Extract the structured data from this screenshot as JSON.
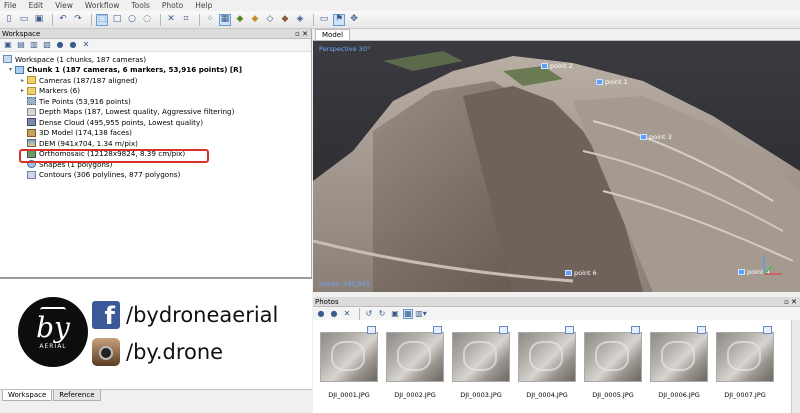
{
  "menu": [
    "File",
    "Edit",
    "View",
    "Workflow",
    "Tools",
    "Photo",
    "Help"
  ],
  "workspace": {
    "title": "Workspace",
    "tree": {
      "root": "Workspace (1 chunks, 187 cameras)",
      "chunk": "Chunk 1 (187 cameras, 6 markers, 53,916 points) [R]",
      "items": [
        {
          "label": "Cameras (187/187 aligned)",
          "icon": "folder-icon",
          "expandable": true
        },
        {
          "label": "Markers (6)",
          "icon": "folder-icon",
          "expandable": true
        },
        {
          "label": "Tie Points (53,916 points)",
          "icon": "tie-points-icon",
          "expandable": false
        },
        {
          "label": "Depth Maps (187, Lowest quality, Aggressive filtering)",
          "icon": "depth-maps-icon",
          "expandable": false
        },
        {
          "label": "Dense Cloud (495,955 points, Lowest quality)",
          "icon": "dense-cloud-icon",
          "expandable": false,
          "highlighted": true
        },
        {
          "label": "3D Model (174,138 faces)",
          "icon": "mesh-icon",
          "expandable": false
        },
        {
          "label": "DEM (941x704, 1.34 m/pix)",
          "icon": "dem-icon",
          "expandable": false
        },
        {
          "label": "Orthomosaic (12128x9824, 8.39 cm/pix)",
          "icon": "orthomosaic-icon",
          "expandable": false
        },
        {
          "label": "Shapes (1 polygons)",
          "icon": "shapes-icon",
          "expandable": false
        },
        {
          "label": "Contours (306 polylines, 877 polygons)",
          "icon": "contours-icon",
          "expandable": false
        }
      ]
    },
    "bottom_tabs": [
      "Workspace",
      "Reference"
    ],
    "highlight_color": "#d8322a"
  },
  "branding": {
    "logo_text": "by",
    "logo_subtext": "AERIAL",
    "facebook_handle": "/bydroneaerial",
    "instagram_handle": "/by.drone",
    "facebook_color": "#3b5998"
  },
  "model": {
    "tab": "Model",
    "projection": "Perspective 30°",
    "points_label": "points: 495,955",
    "markers": [
      "point 1",
      "point 2",
      "point 3",
      "point 4",
      "point 6"
    ]
  },
  "photos": {
    "title": "Photos",
    "files": [
      "DJI_0001.JPG",
      "DJI_0002.JPG",
      "DJI_0003.JPG",
      "DJI_0004.JPG",
      "DJI_0005.JPG",
      "DJI_0006.JPG",
      "DJI_0007.JPG"
    ]
  }
}
